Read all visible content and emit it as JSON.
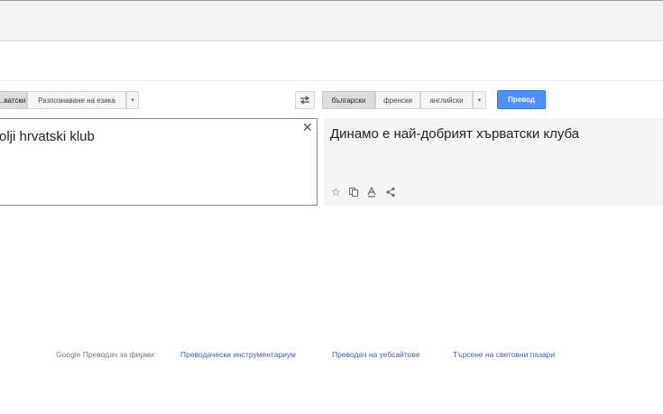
{
  "source_languages": {
    "selected": "...ватски",
    "detect": "Разпознаване на езика",
    "dropdown": "▾"
  },
  "target_languages": {
    "items": [
      "български",
      "френски",
      "английски"
    ],
    "dropdown": "▾"
  },
  "translate_button": "Превод",
  "source_text": "olji hrvatski klub",
  "translation": "Динамо е най-добрият хърватски клуба",
  "clear_icon": "close-icon",
  "actions": [
    "star-icon",
    "copy-icon",
    "spellcheck-icon",
    "share-icon"
  ],
  "footer": {
    "label": "Google Преводач за фирми:",
    "links": [
      "Преводачески инструментариум",
      "Преводач на уебсайтове",
      "Търсене на световни пазари"
    ]
  },
  "colors": {
    "accent": "#4d90fe",
    "link": "#3c5ca8"
  }
}
